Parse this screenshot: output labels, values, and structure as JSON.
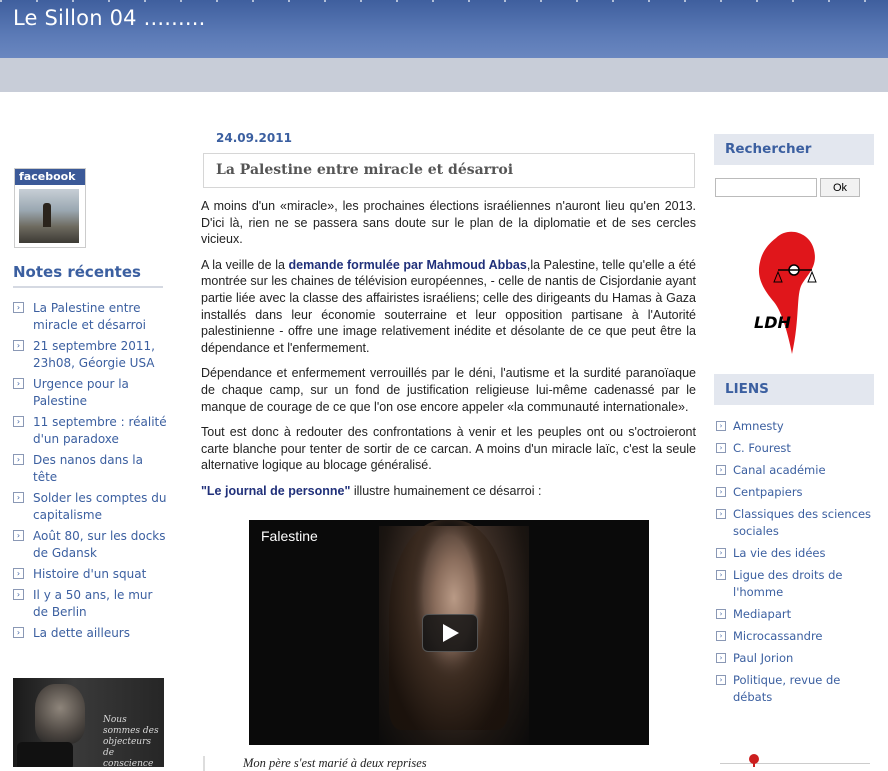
{
  "site": {
    "title": "Le Sillon 04 ........."
  },
  "left": {
    "facebook_label": "facebook",
    "recent_heading": "Notes récentes",
    "recent_items": [
      "La Palestine entre miracle et désarroi",
      "21 septembre 2011, 23h08, Géorgie USA",
      "Urgence pour la Palestine",
      "11 septembre : réalité d'un paradoxe",
      "Des nanos dans la tête",
      "Solder les comptes du capitalisme",
      "Août 80, sur les docks de Gdansk",
      "Histoire d'un squat",
      "Il y a 50 ans, le mur de Berlin",
      "La dette ailleurs"
    ],
    "video_text": "Nous sommes des objecteurs de conscience israéliens."
  },
  "post": {
    "date": "24.09.2011",
    "title": "La Palestine entre miracle et désarroi",
    "p1": "A moins d'un «miracle», les prochaines élections israéliennes n'auront lieu qu'en 2013. D'ici là, rien ne se passera sans doute sur le plan de la diplomatie et de ses cercles vicieux.",
    "p2_before": "A la veille de la ",
    "p2_link": "demande formulée par Mahmoud Abbas",
    "p2_after": ",la Palestine, telle qu'elle a été montrée sur les chaines de télévision européennes, - celle de nantis de Cisjordanie ayant partie liée avec la classe des affairistes israéliens; celle des dirigeants du Hamas à Gaza installés dans leur économie souterraine et leur opposition partisane à l'Autorité palestinienne - offre une image relativement inédite et désolante de ce que peut être la dépendance et l'enfermement.",
    "p3": "Dépendance et enfermement verrouillés par le déni, l'autisme et la surdité paranoïaque de chaque camp, sur un fond de justification religieuse lui-même cadenassé par le manque de courage de ce que l'on ose encore appeler «la communauté internationale».",
    "p4": "Tout est donc à redouter des confrontations à venir et les peuples ont ou s'octroieront carte blanche pour tenter de sortir de ce carcan. A moins d'un miracle laïc, c'est la seule alternative logique au blocage généralisé.",
    "p5_link": "\"Le journal de personne\"",
    "p5_after": " illustre humainement ce désarroi :",
    "video_title": "Falestine",
    "quote": "Mon père s'est marié à deux reprises"
  },
  "right": {
    "search_heading": "Rechercher",
    "search_value": "",
    "search_button": "Ok",
    "logo_text": "LDH",
    "links_heading": "LIENS",
    "links": [
      "Amnesty",
      "C. Fourest",
      "Canal académie",
      "Centpapiers",
      "Classiques des sciences sociales",
      "La vie des idées",
      "Ligue des droits de l'homme",
      "Mediapart",
      "Microcassandre",
      "Paul Jorion",
      "Politique, revue de débats"
    ]
  }
}
